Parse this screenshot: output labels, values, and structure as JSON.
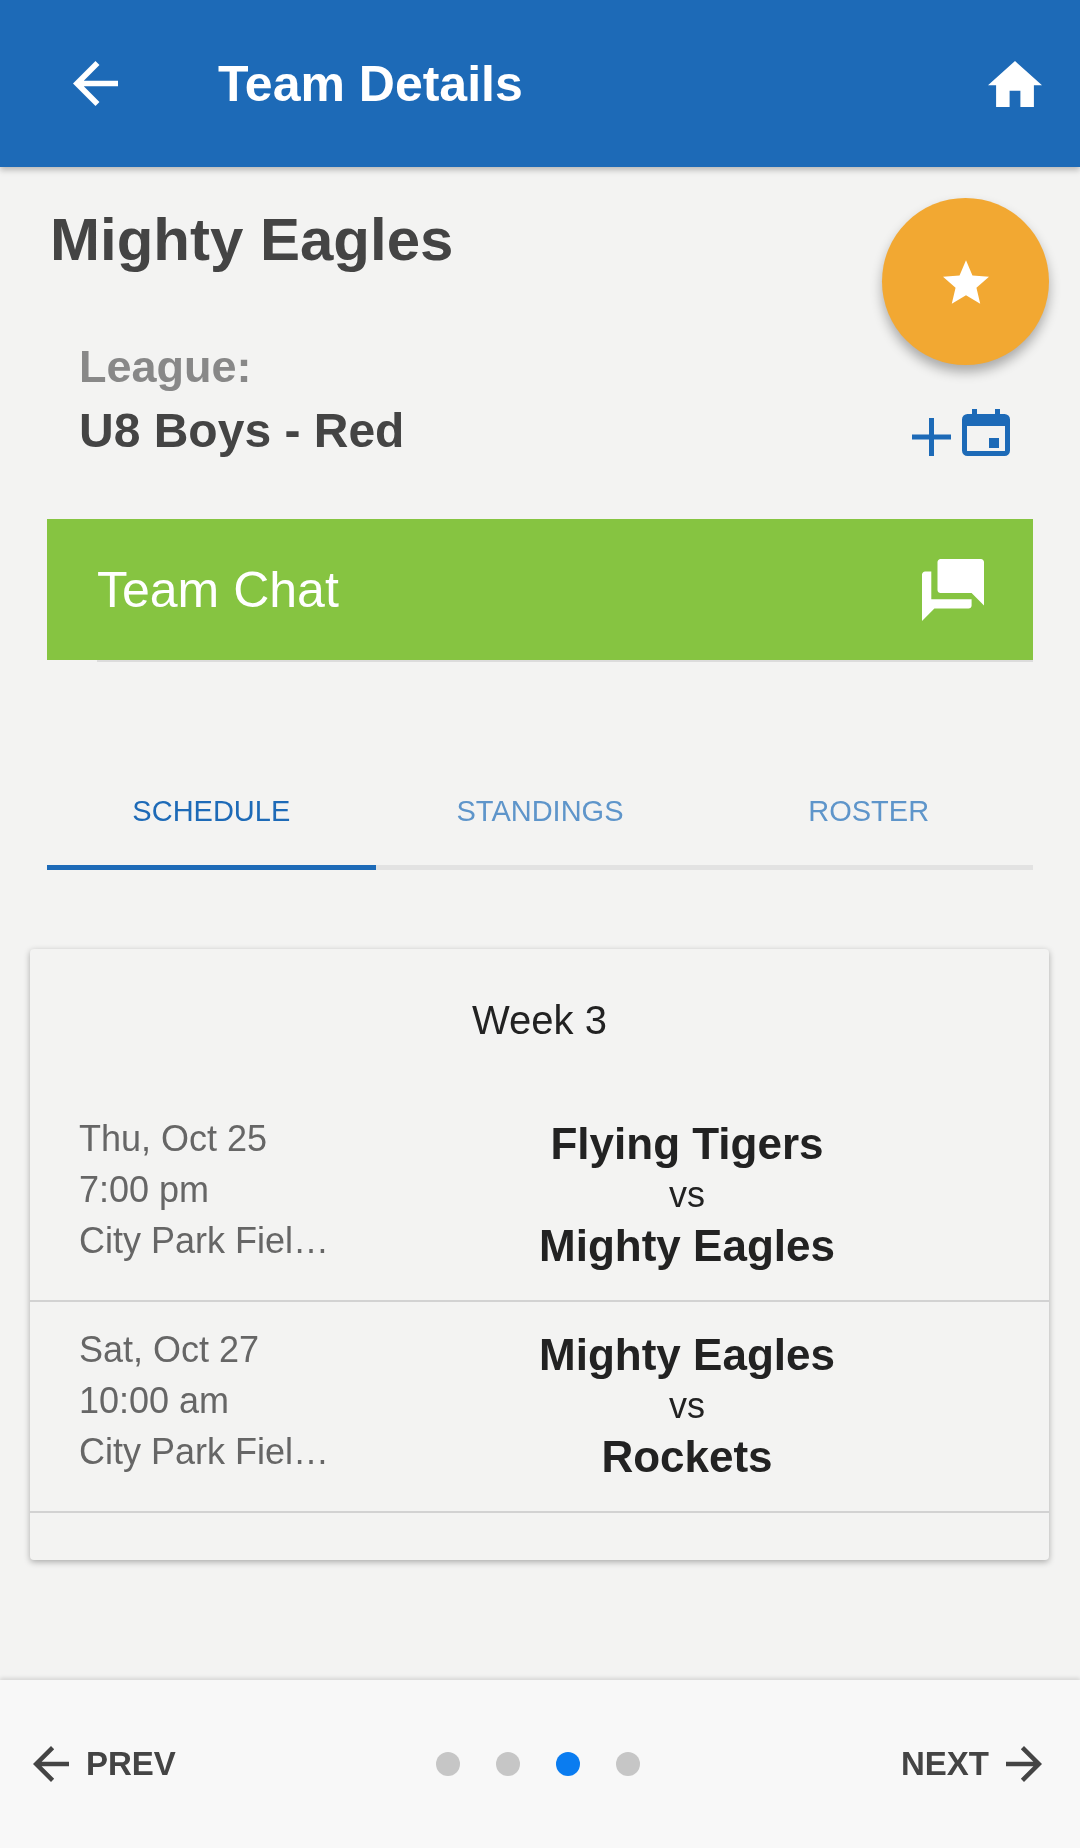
{
  "app_bar": {
    "title": "Team Details"
  },
  "team": {
    "name": "Mighty Eagles",
    "league_label": "League:",
    "league": "U8 Boys - Red"
  },
  "team_chat": {
    "label": "Team Chat"
  },
  "tabs": [
    {
      "label": "SCHEDULE",
      "selected": true
    },
    {
      "label": "STANDINGS",
      "selected": false
    },
    {
      "label": "ROSTER",
      "selected": false
    }
  ],
  "schedule": {
    "week": "Week 3",
    "games": [
      {
        "date": "Thu, Oct 25",
        "time": "7:00 pm",
        "location": "City Park Fiel…",
        "teams": [
          "Flying Tigers",
          "Mighty Eagles"
        ],
        "vs": "vs"
      },
      {
        "date": "Sat, Oct 27",
        "time": "10:00 am",
        "location": "City Park Fiel…",
        "teams": [
          "Mighty Eagles",
          "Rockets"
        ],
        "vs": "vs"
      }
    ]
  },
  "pager": {
    "prev": "PREV",
    "next": "NEXT",
    "pages": [
      {
        "selected": false
      },
      {
        "selected": false
      },
      {
        "selected": true
      },
      {
        "selected": false
      }
    ]
  }
}
